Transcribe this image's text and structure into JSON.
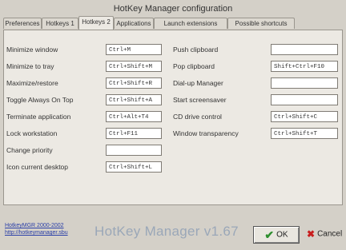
{
  "window": {
    "title": "HotKey Manager configuration"
  },
  "tabs": [
    {
      "label": "Preferences"
    },
    {
      "label": "Hotkeys 1"
    },
    {
      "label": "Hotkeys 2"
    },
    {
      "label": "Applications"
    },
    {
      "label": "Launch extensions"
    },
    {
      "label": "Possible shortcuts"
    }
  ],
  "left_fields": [
    {
      "label": "Minimize window",
      "value": "Ctrl+M"
    },
    {
      "label": "Minimize to tray",
      "value": "Ctrl+Shift+M"
    },
    {
      "label": "Maximize/restore",
      "value": "Ctrl+Shift+R"
    },
    {
      "label": "Toggle Always On Top",
      "value": "Ctrl+Shift+A"
    },
    {
      "label": "Terminate application",
      "value": "Ctrl+Alt+T4"
    },
    {
      "label": "Lock workstation",
      "value": "Ctrl+F11"
    },
    {
      "label": "Change priority",
      "value": ""
    },
    {
      "label": "Icon current desktop",
      "value": "Ctrl+Shift+L"
    }
  ],
  "right_fields": [
    {
      "label": "Push clipboard",
      "value": ""
    },
    {
      "label": "Pop clipboard",
      "value": "Shift+Ctrl+F10"
    },
    {
      "label": "Dial-up Manager",
      "value": ""
    },
    {
      "label": "Start screensaver",
      "value": ""
    },
    {
      "label": "CD drive control",
      "value": "Ctrl+Shift+C"
    },
    {
      "label": "Window transparency",
      "value": "Ctrl+Shift+T"
    }
  ],
  "footer": {
    "link_line1": "HotkeyMGR 2000-2002",
    "link_line2": "http://hotkeymanager.sbu",
    "brand": "HotKey Manager v1.67",
    "ok_label": "OK",
    "cancel_label": "Cancel"
  }
}
